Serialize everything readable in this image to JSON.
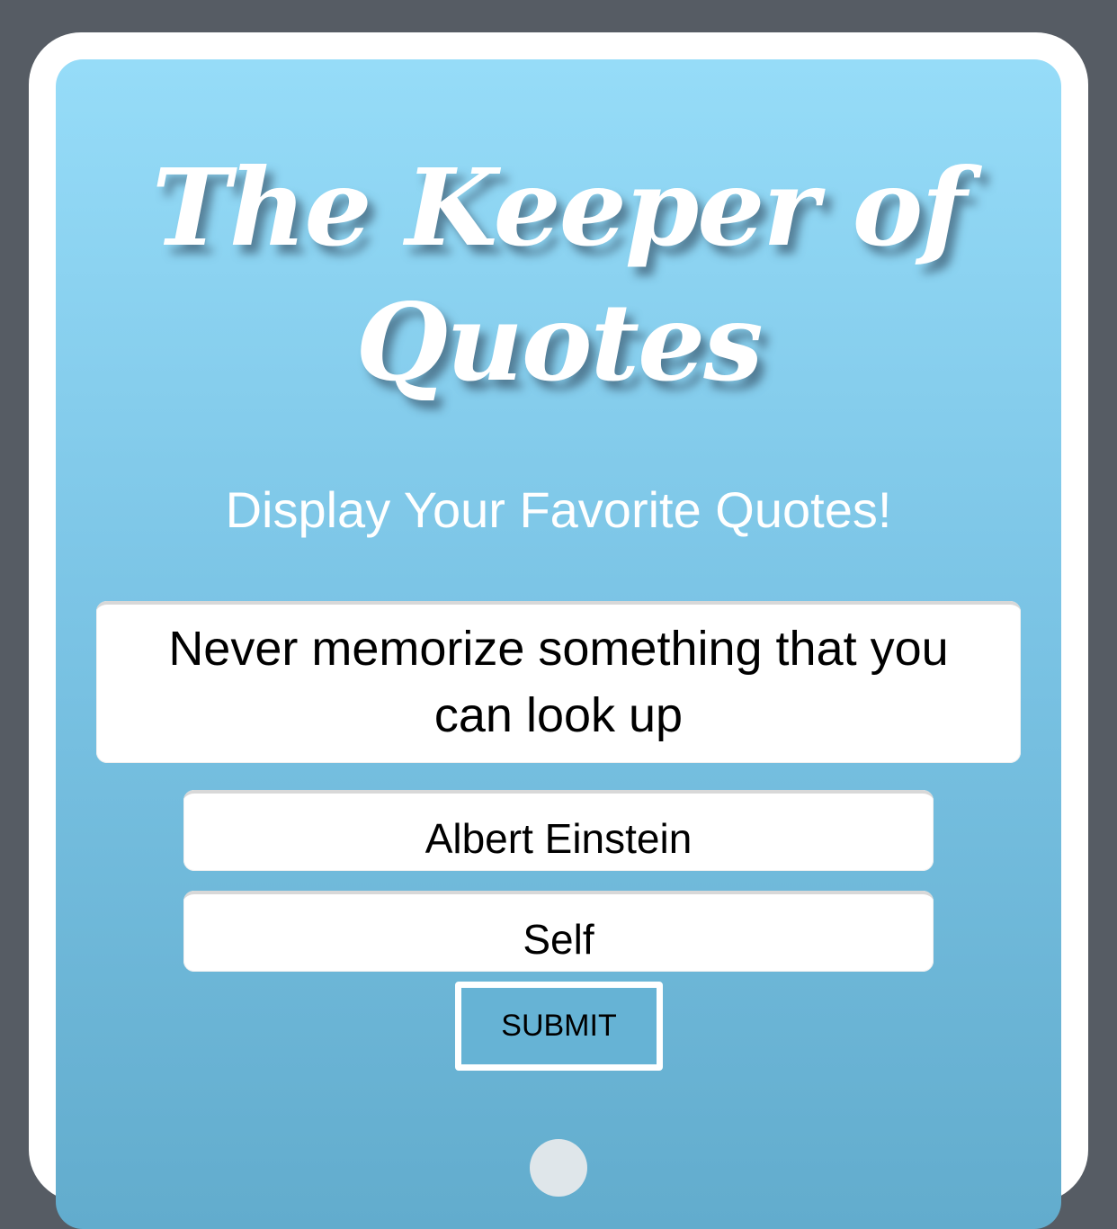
{
  "header": {
    "title_line1": "The Keeper of",
    "title_line2": "Quotes",
    "subtitle": "Display Your Favorite Quotes!"
  },
  "form": {
    "quote_value": "Never memorize something that you can look up",
    "author_value": "Albert Einstein",
    "source_value": "Self",
    "submit_label": "SUBMIT"
  },
  "colors": {
    "page_background": "#565c64",
    "frame": "#ffffff",
    "panel_gradient_top": "#96dcf8",
    "panel_gradient_bottom": "#62accd",
    "submit_fill": "#66b3d5"
  }
}
